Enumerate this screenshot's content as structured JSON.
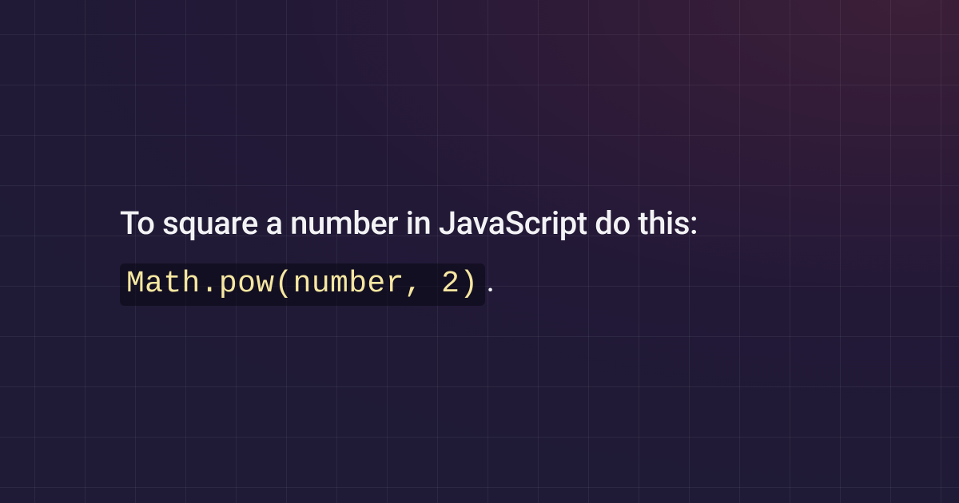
{
  "heading": "To square a number in JavaScript do this:",
  "code": "Math.pow(number, 2)",
  "period": "."
}
